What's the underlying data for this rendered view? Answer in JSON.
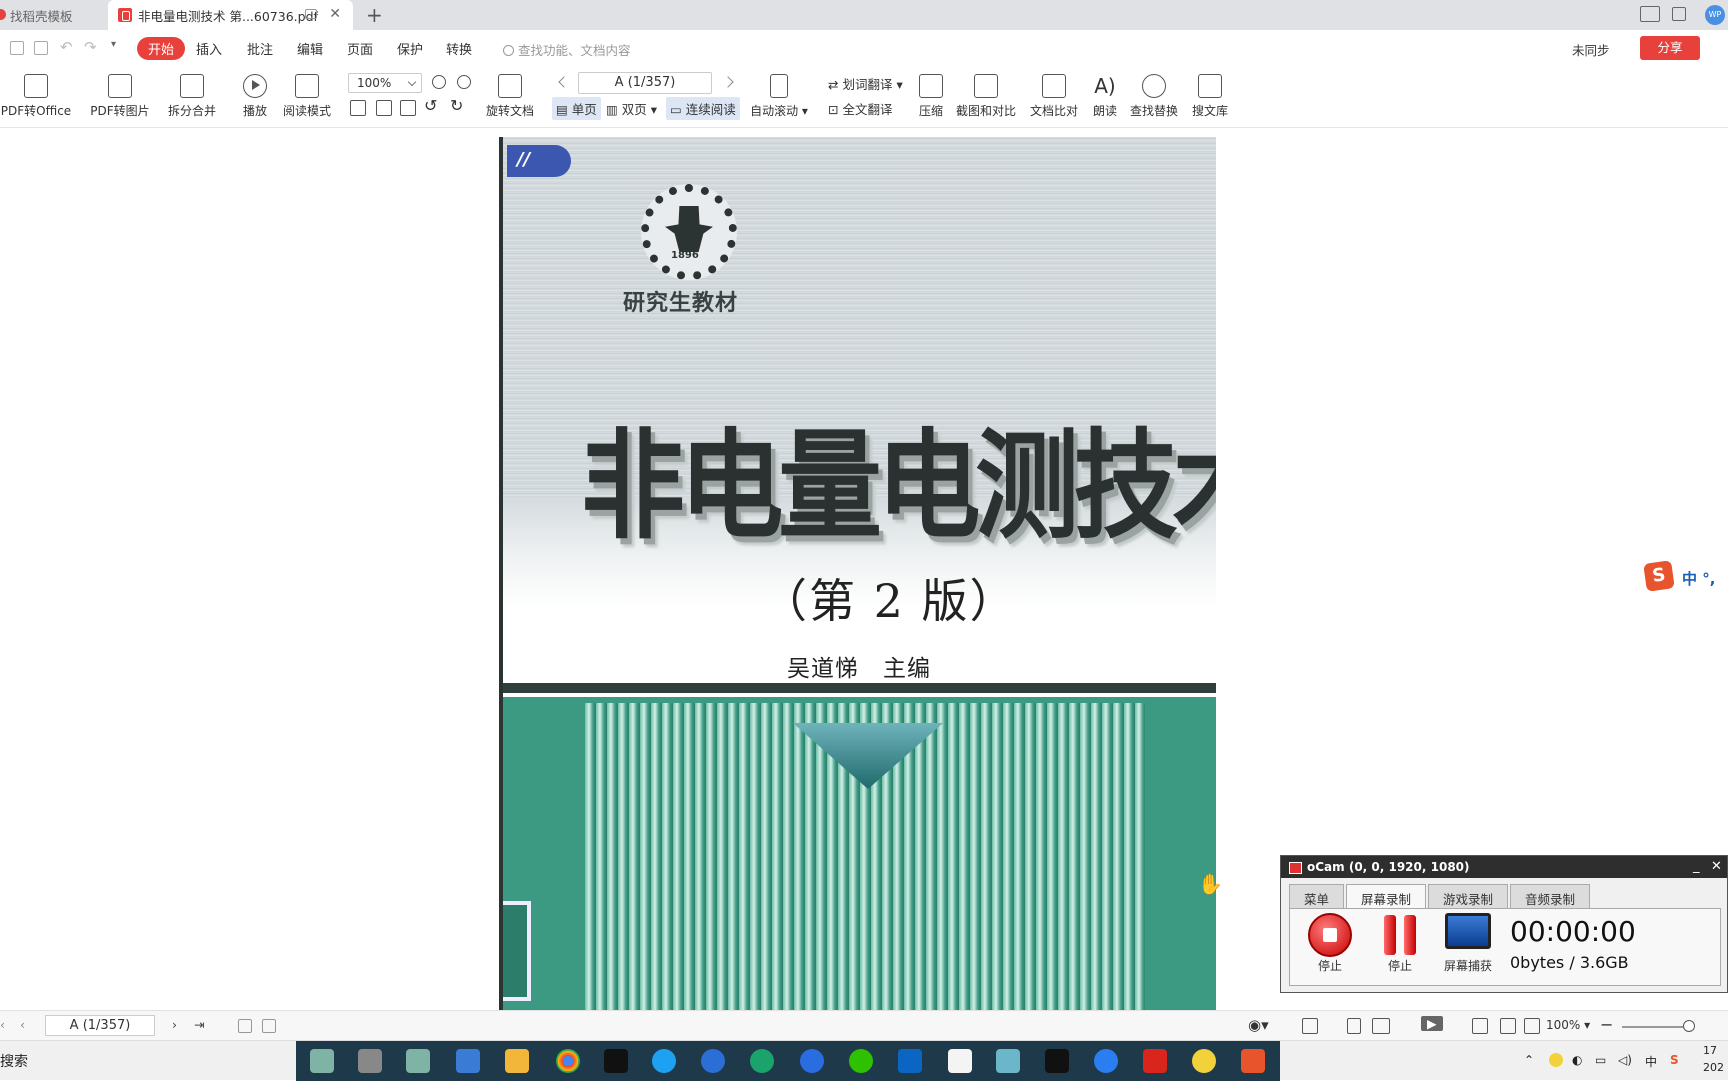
{
  "tabs": [
    {
      "label": "找稻壳模板"
    },
    {
      "label": "非电量电测技术 第...60736.pdf"
    }
  ],
  "menu": {
    "items": [
      "开始",
      "插入",
      "批注",
      "编辑",
      "页面",
      "保护",
      "转换"
    ],
    "search_placeholder": "查找功能、文档内容",
    "sync": "未同步",
    "share": "分享"
  },
  "ribbon": {
    "pdf_to_office": "PDF转Office",
    "pdf_to_image": "PDF转图片",
    "split_merge": "拆分合并",
    "play": "播放",
    "read_mode": "阅读模式",
    "zoom": "100%",
    "rotate_doc": "旋转文档",
    "page_indicator": "A (1/357)",
    "single_page": "单页",
    "double_page": "双页",
    "continuous": "连续阅读",
    "auto_scroll": "自动滚动",
    "word_translate": "划词翻译",
    "full_translate": "全文翻译",
    "compress": "压缩",
    "screenshot_compare": "截图和对比",
    "doc_compare": "文档比对",
    "read_aloud": "朗读",
    "find_replace": "查找替换",
    "search_library": "搜文库"
  },
  "book": {
    "series": "研究生教材",
    "emblem_year": "1896",
    "title": "非电量电测技术",
    "edition": "（第 2 版）",
    "author": "吴道悌　主编",
    "tab_mark": "//"
  },
  "statusbar": {
    "page_indicator": "A (1/357)",
    "zoom": "100%"
  },
  "ocam": {
    "title": "oCam (0, 0, 1920, 1080)",
    "tabs": [
      "菜单",
      "屏幕录制",
      "游戏录制",
      "音频录制"
    ],
    "buttons": [
      "停止",
      "停止",
      "屏幕捕获"
    ],
    "timer": "00:00:00",
    "size": "0bytes / 3.6GB"
  },
  "ime": {
    "label": "中"
  },
  "taskbar": {
    "search": "搜索",
    "tray_ime": "中",
    "clock_partial": "17",
    "date_partial": "202"
  }
}
